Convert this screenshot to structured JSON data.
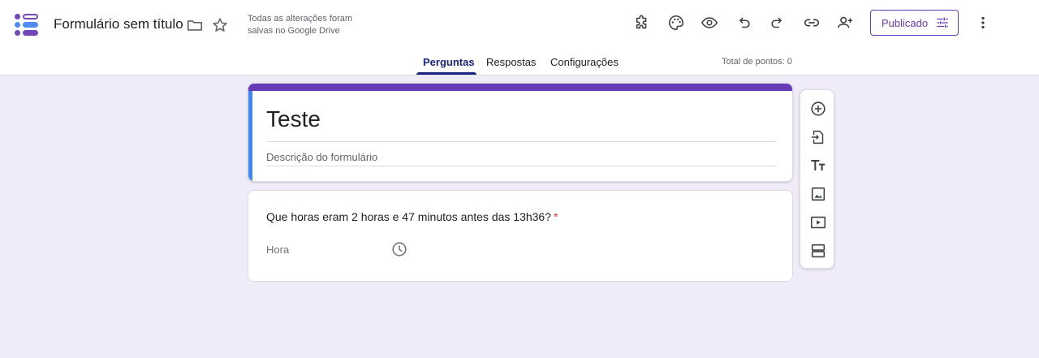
{
  "header": {
    "title": "Formulário sem título",
    "save_status": "Todas as alterações foram salvas no Google Drive",
    "publish_label": "Publicado",
    "icons": [
      "folder-icon",
      "star-icon",
      "addons-icon",
      "palette-icon",
      "preview-icon",
      "undo-icon",
      "redo-icon",
      "link-icon",
      "add-collaborator-icon",
      "more-vert-icon"
    ]
  },
  "tabs": [
    {
      "label": "Perguntas",
      "active": true
    },
    {
      "label": "Respostas",
      "active": false
    },
    {
      "label": "Configurações",
      "active": false
    }
  ],
  "points_label": "Total de pontos: 0",
  "form": {
    "title": "Teste",
    "description_placeholder": "Descrição do formulário"
  },
  "question": {
    "text": "Que horas eram 2 horas e 47 minutos antes das 13h36?",
    "required_mark": "*",
    "answer_label": "Hora"
  },
  "toolbar_icons": [
    "add-question-icon",
    "import-questions-icon",
    "add-title-icon",
    "add-image-icon",
    "add-video-icon",
    "add-section-icon"
  ],
  "colors": {
    "accent": "#673ab7",
    "background": "#f0ebf8",
    "tab_active": "#1a237e",
    "title_left_bar": "#4285f4",
    "required": "#d93025"
  }
}
